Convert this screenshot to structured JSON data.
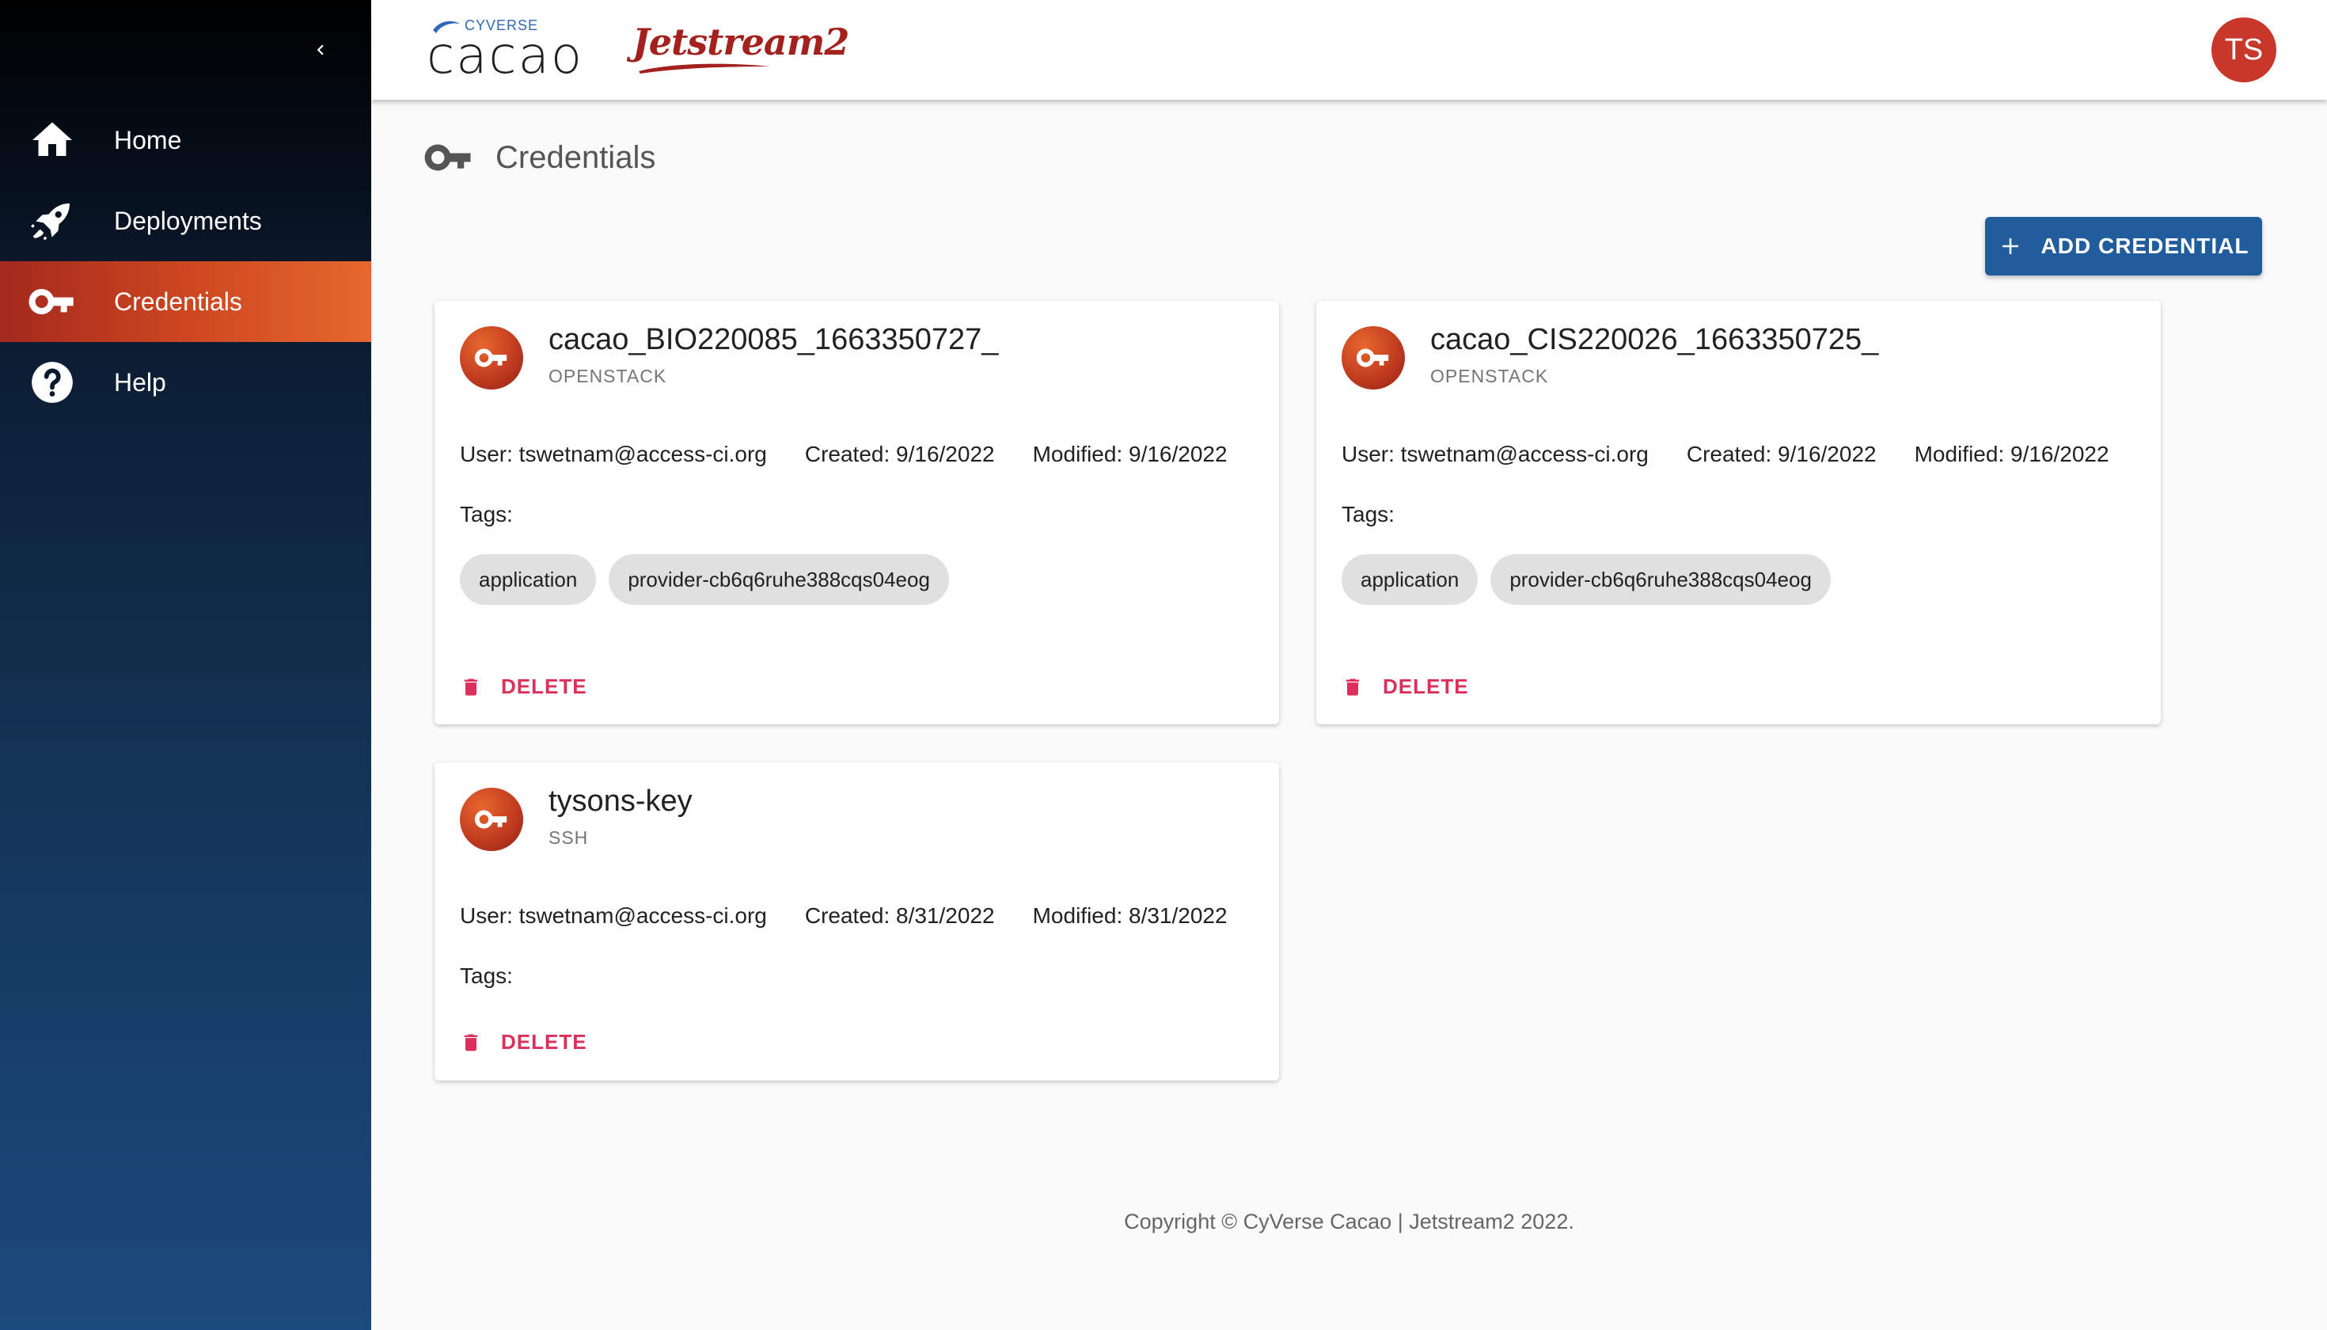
{
  "brand": {
    "cyverse": "CYVERSE",
    "cacao": "cacao",
    "jetstream": "Jetstream2"
  },
  "user": {
    "initials": "TS"
  },
  "sidebar": {
    "items": [
      {
        "label": "Home",
        "icon": "home-icon"
      },
      {
        "label": "Deployments",
        "icon": "rocket-icon"
      },
      {
        "label": "Credentials",
        "icon": "key-icon",
        "active": true
      },
      {
        "label": "Help",
        "icon": "help-icon"
      }
    ]
  },
  "page": {
    "title": "Credentials"
  },
  "actions": {
    "add_credential": "ADD CREDENTIAL"
  },
  "credentials": [
    {
      "name": "cacao_BIO220085_1663350727_",
      "type": "OPENSTACK",
      "user": "User: tswetnam@access-ci.org",
      "created": "Created: 9/16/2022",
      "modified": "Modified: 9/16/2022",
      "tags_label": "Tags:",
      "tags": [
        "application",
        "provider-cb6q6ruhe388cqs04eog"
      ],
      "delete_label": "DELETE"
    },
    {
      "name": "cacao_CIS220026_1663350725_",
      "type": "OPENSTACK",
      "user": "User: tswetnam@access-ci.org",
      "created": "Created: 9/16/2022",
      "modified": "Modified: 9/16/2022",
      "tags_label": "Tags:",
      "tags": [
        "application",
        "provider-cb6q6ruhe388cqs04eog"
      ],
      "delete_label": "DELETE"
    },
    {
      "name": "tysons-key",
      "type": "SSH",
      "user": "User: tswetnam@access-ci.org",
      "created": "Created: 8/31/2022",
      "modified": "Modified: 8/31/2022",
      "tags_label": "Tags:",
      "tags": [],
      "delete_label": "DELETE"
    }
  ],
  "footer": {
    "text": "Copyright © CyVerse Cacao | Jetstream2 2022."
  },
  "colors": {
    "accent_orange": "#e8672d",
    "primary_blue": "#215c9c",
    "delete_red": "#dc2f5a",
    "avatar": "#c8382a"
  }
}
